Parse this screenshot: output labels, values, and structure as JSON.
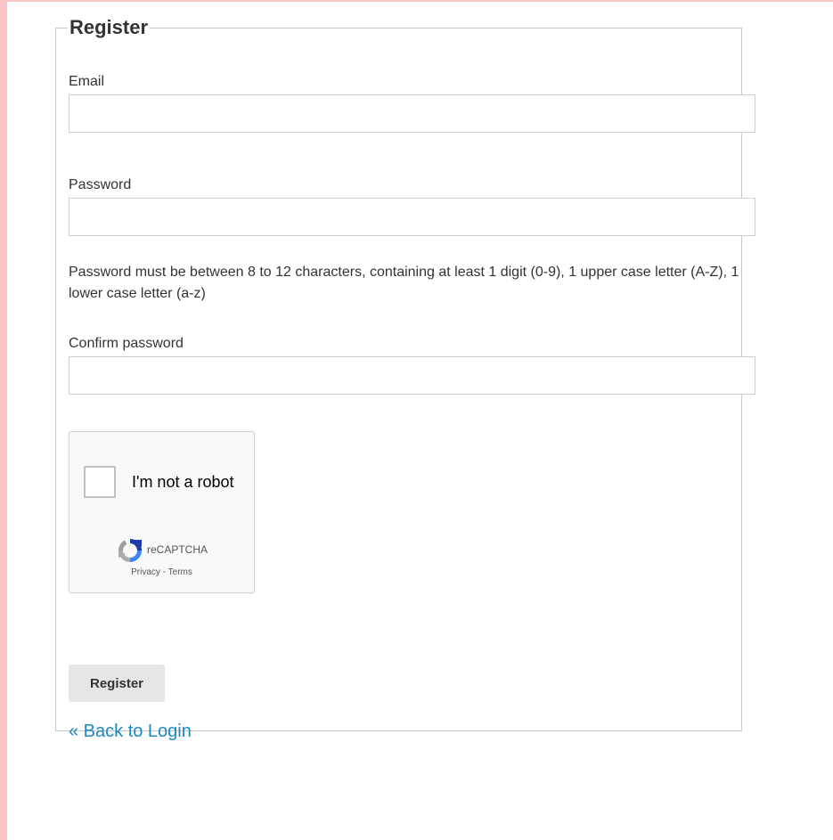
{
  "form": {
    "title": "Register",
    "email": {
      "label": "Email",
      "value": "",
      "placeholder": ""
    },
    "password": {
      "label": "Password",
      "value": "",
      "placeholder": ""
    },
    "password_hint": "Password must be between 8 to 12 characters, containing at least 1 digit (0-9), 1 upper case letter (A-Z), 1 lower case letter (a-z)",
    "confirm_password": {
      "label": "Confirm password",
      "value": "",
      "placeholder": ""
    },
    "captcha": {
      "checkbox_label": "I'm not a robot",
      "brand": "reCAPTCHA",
      "privacy_link": "Privacy",
      "separator": " - ",
      "terms_link": "Terms",
      "logo_icon": "recaptcha-logo-icon",
      "checked": false
    },
    "submit_label": "Register",
    "back_link": "« Back to Login"
  },
  "colors": {
    "accent_border": "#f7c5c5",
    "link": "#1b89c4",
    "button_bg": "#e6e6e6"
  }
}
